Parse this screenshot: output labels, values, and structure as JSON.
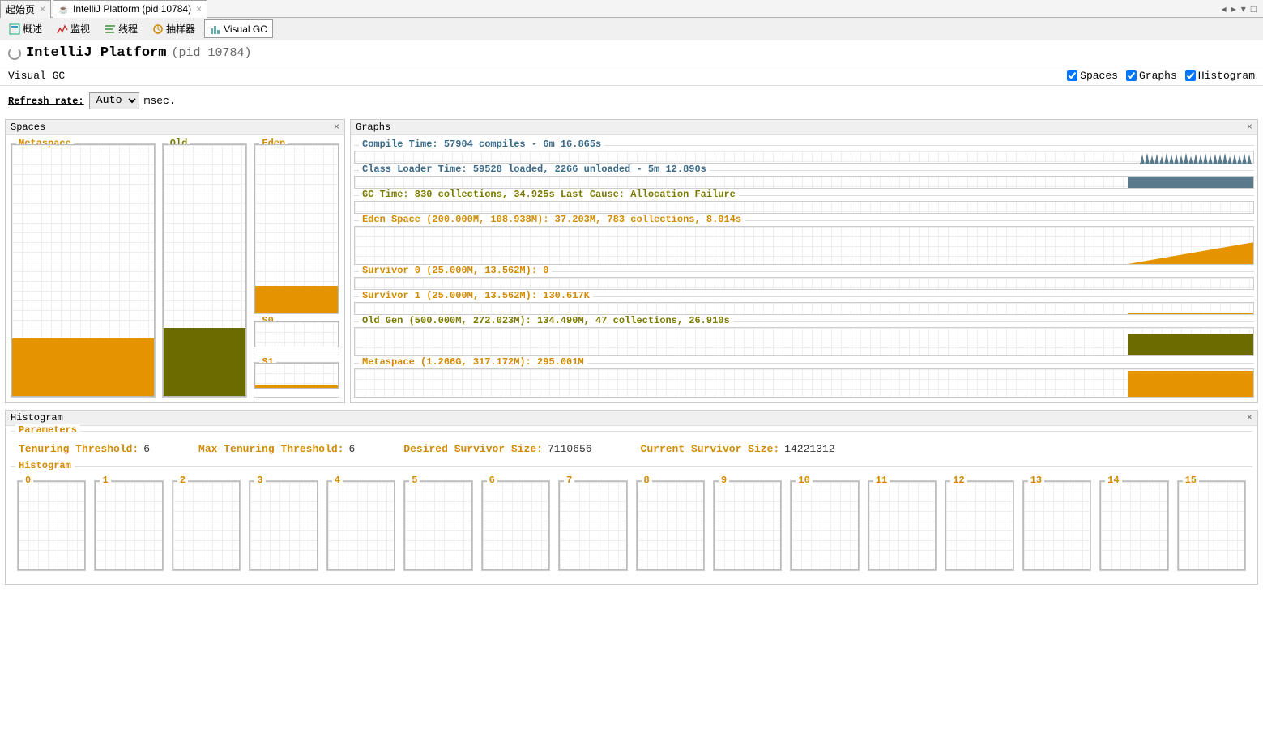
{
  "tabs": {
    "start": "起始页",
    "active": "IntelliJ Platform (pid 10784)"
  },
  "toolbar": {
    "overview": "概述",
    "monitor": "监视",
    "threads": "线程",
    "sampler": "抽样器",
    "visualgc": "Visual GC"
  },
  "title": {
    "main": "IntelliJ Platform",
    "sub": "(pid 10784)"
  },
  "subheader": {
    "label": "Visual GC",
    "chk_spaces": "Spaces",
    "chk_graphs": "Graphs",
    "chk_histogram": "Histogram"
  },
  "refresh": {
    "label": "Refresh rate:",
    "value": "Auto",
    "unit": "msec."
  },
  "panels": {
    "spaces_title": "Spaces",
    "graphs_title": "Graphs"
  },
  "spaces": {
    "metaspace": "Metaspace",
    "old": "Old",
    "eden": "Eden",
    "s0": "S0",
    "s1": "S1"
  },
  "graphs": {
    "compile": "Compile Time: 57904 compiles - 6m 16.865s",
    "classloader": "Class Loader Time: 59528 loaded, 2266 unloaded - 5m 12.890s",
    "gc": "GC Time: 830 collections, 34.925s  Last Cause: Allocation Failure",
    "eden": "Eden Space (200.000M, 108.938M): 37.203M, 783 collections, 8.014s",
    "s0": "Survivor 0 (25.000M, 13.562M): 0",
    "s1": "Survivor 1 (25.000M, 13.562M): 130.617K",
    "oldgen": "Old Gen (500.000M, 272.023M): 134.490M, 47 collections, 26.910s",
    "metaspace": "Metaspace (1.266G, 317.172M): 295.001M"
  },
  "histogram": {
    "title": "Histogram",
    "params_title": "Parameters",
    "histo_title": "Histogram",
    "tenuring_k": "Tenuring Threshold:",
    "tenuring_v": "6",
    "maxten_k": "Max Tenuring Threshold:",
    "maxten_v": "6",
    "desired_k": "Desired Survivor Size:",
    "desired_v": "7110656",
    "current_k": "Current Survivor Size:",
    "current_v": "14221312",
    "buckets": [
      "0",
      "1",
      "2",
      "3",
      "4",
      "5",
      "6",
      "7",
      "8",
      "9",
      "10",
      "11",
      "12",
      "13",
      "14",
      "15"
    ]
  },
  "chart_data": {
    "spaces_fill_pct": {
      "metaspace": 23,
      "old": 27,
      "eden": 12,
      "s0": 0,
      "s1": 1
    },
    "graph_right_fill": {
      "compile": {
        "w_pct": 15,
        "h_pct": 100,
        "color": "steel",
        "shape": "scribble"
      },
      "classloader": {
        "w_pct": 14,
        "h_pct": 100,
        "color": "steel",
        "shape": "block"
      },
      "gc": {
        "w_pct": 0,
        "h_pct": 0
      },
      "eden": {
        "w_pct": 14,
        "h_pct": 55,
        "color": "orange",
        "shape": "triangle"
      },
      "s0": {
        "w_pct": 0,
        "h_pct": 0
      },
      "s1": {
        "w_pct": 14,
        "h_pct": 6,
        "color": "orange",
        "shape": "block"
      },
      "oldgen": {
        "w_pct": 14,
        "h_pct": 80,
        "color": "olive",
        "shape": "block"
      },
      "metaspace": {
        "w_pct": 14,
        "h_pct": 95,
        "color": "orange",
        "shape": "block"
      }
    }
  }
}
